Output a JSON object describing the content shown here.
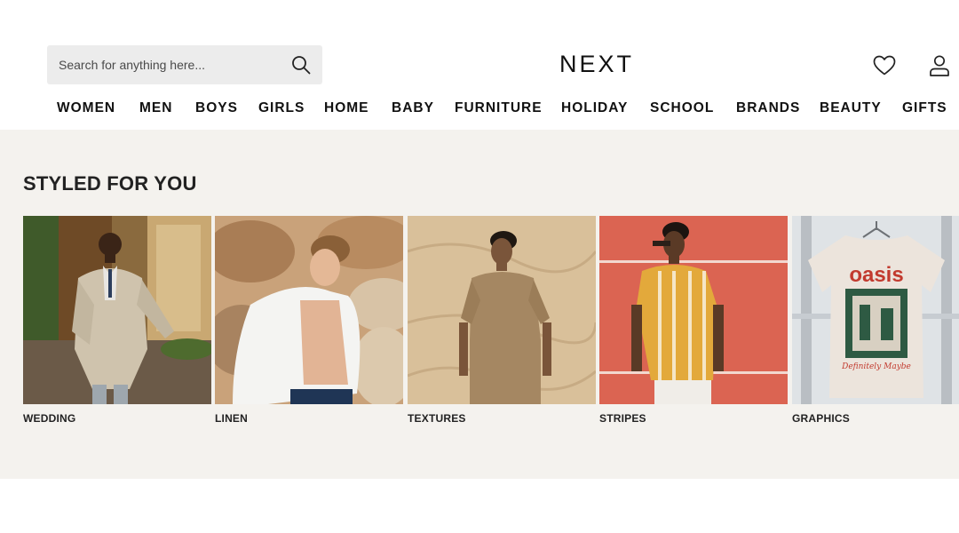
{
  "brand": {
    "logo_text": "NEXT"
  },
  "search": {
    "placeholder": "Search for anything here..."
  },
  "header_icons": {
    "favourites": "heart-icon",
    "account": "account-icon",
    "search": "search-icon"
  },
  "nav": {
    "items": [
      {
        "label": "WOMEN"
      },
      {
        "label": "MEN"
      },
      {
        "label": "BOYS"
      },
      {
        "label": "GIRLS"
      },
      {
        "label": "HOME"
      },
      {
        "label": "BABY"
      },
      {
        "label": "FURNITURE"
      },
      {
        "label": "HOLIDAY"
      },
      {
        "label": "SCHOOL"
      },
      {
        "label": "BRANDS"
      },
      {
        "label": "BEAUTY"
      },
      {
        "label": "GIFTS"
      }
    ]
  },
  "styled": {
    "title": "STYLED FOR YOU",
    "cards": [
      {
        "label": "WEDDING"
      },
      {
        "label": "LINEN"
      },
      {
        "label": "TEXTURES"
      },
      {
        "label": "STRIPES"
      },
      {
        "label": "GRAPHICS",
        "tee_print_top": "oasis",
        "tee_print_bottom": "Definitely Maybe"
      }
    ]
  },
  "colors": {
    "band_background": "#f4f2ee",
    "search_background": "#ececec",
    "text": "#111111"
  }
}
